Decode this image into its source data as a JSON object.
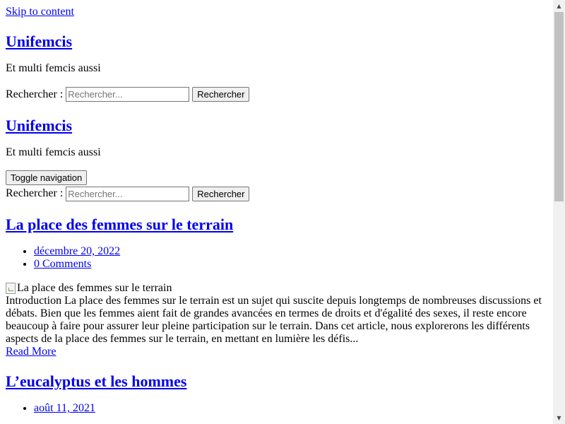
{
  "skip_link": "Skip to content",
  "header": {
    "site_title": "Unifemcis",
    "tagline": "Et multi femcis aussi"
  },
  "search": {
    "label": "Rechercher :",
    "placeholder": "Rechercher...",
    "button": "Rechercher"
  },
  "nav": {
    "toggle_label": "Toggle navigation"
  },
  "posts": [
    {
      "title": "La place des femmes sur le terrain",
      "date": "décembre 20, 2022",
      "comments": "0 Comments",
      "image_alt": "La place des femmes sur le terrain",
      "excerpt": "Introduction La place des femmes sur le terrain est un sujet qui suscite depuis longtemps de nombreuses discussions et débats. Bien que les femmes aient fait de grandes avancées en termes de droits et d'égalité des sexes, il reste encore beaucoup à faire pour assurer leur pleine participation sur le terrain. Dans cet article, nous explorerons les différents aspects de la place des femmes sur le terrain, en mettant en lumière les défis...",
      "read_more": "Read More"
    },
    {
      "title": "L’eucalyptus et les hommes",
      "date": "août 11, 2021"
    }
  ],
  "scrollbar": {
    "up_icon": "scroll-up-arrow-icon",
    "down_icon": "scroll-down-arrow-icon"
  }
}
